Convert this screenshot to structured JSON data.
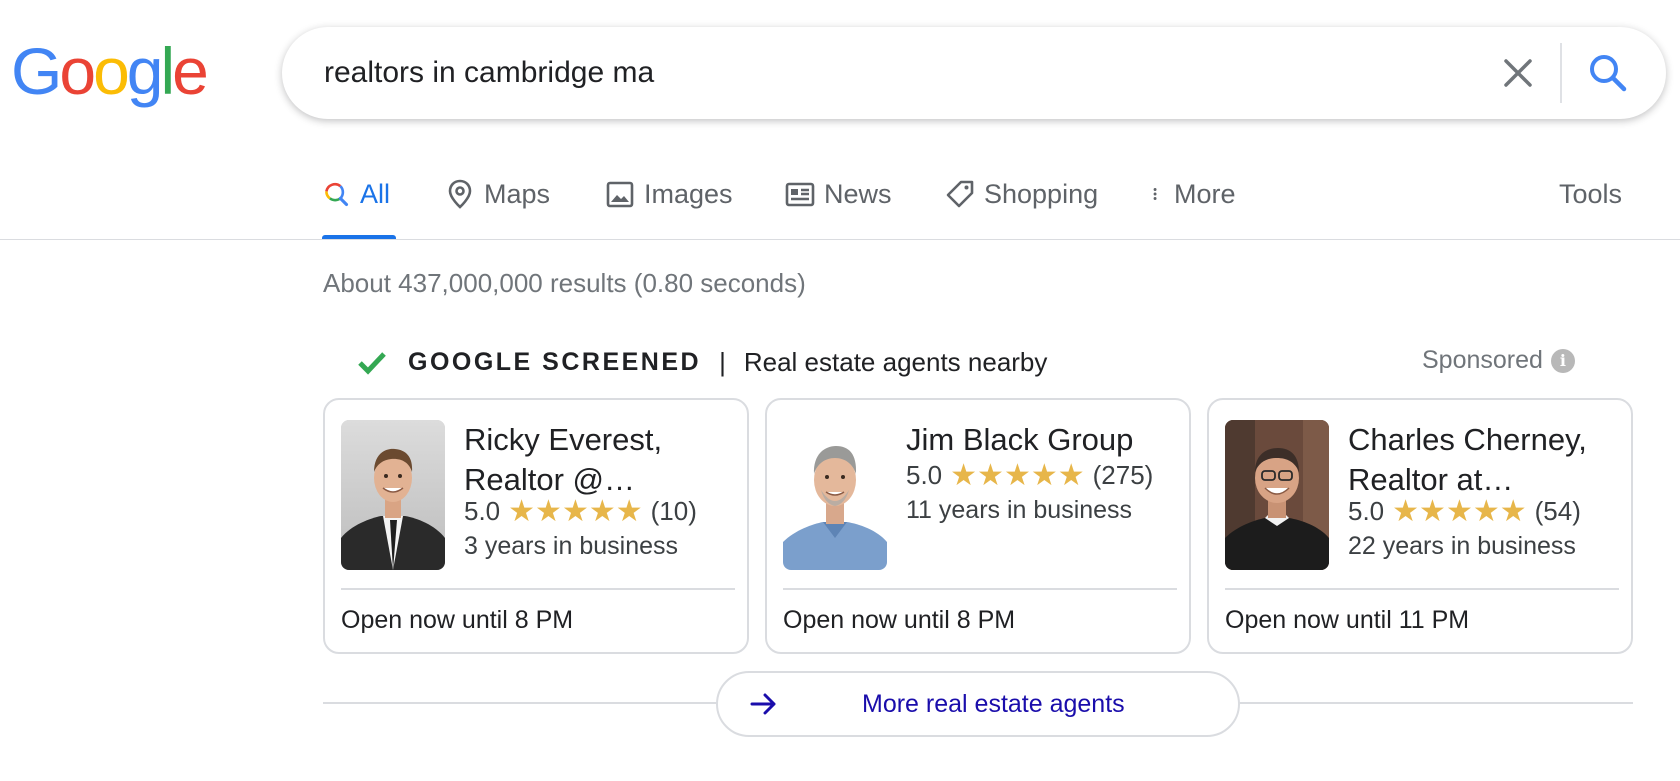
{
  "logo": {
    "letters": [
      "G",
      "o",
      "o",
      "g",
      "l",
      "e"
    ],
    "colors": [
      "#4285F4",
      "#EA4335",
      "#FBBC05",
      "#4285F4",
      "#34A853",
      "#EA4335"
    ]
  },
  "search": {
    "query": "realtors in cambridge ma",
    "clear_icon": "close-icon",
    "search_icon": "search-icon"
  },
  "tabs": [
    {
      "label": "All",
      "icon": "search-icon",
      "active": true
    },
    {
      "label": "Maps",
      "icon": "map-pin-icon"
    },
    {
      "label": "Images",
      "icon": "image-icon"
    },
    {
      "label": "News",
      "icon": "newspaper-icon"
    },
    {
      "label": "Shopping",
      "icon": "tag-icon"
    },
    {
      "label": "More",
      "icon": "more-vert-icon"
    }
  ],
  "tools_label": "Tools",
  "result_stats": "About 437,000,000 results (0.80 seconds)",
  "screened": {
    "title": "GOOGLE SCREENED",
    "separator": "|",
    "subtitle": "Real estate agents nearby",
    "sponsored": "Sponsored",
    "info_glyph": "i"
  },
  "agents": [
    {
      "name": "Ricky Everest, Realtor @…",
      "rating": "5.0",
      "stars": "★★★★★",
      "stars_count": 5,
      "reviews": "(10)",
      "years": "3 years in business",
      "hours": "Open now until 8 PM"
    },
    {
      "name": "Jim Black Group",
      "rating": "5.0",
      "stars": "★★★★★",
      "stars_count": 5,
      "reviews": "(275)",
      "years": "11 years in business",
      "hours": "Open now until 8 PM"
    },
    {
      "name": "Charles Cherney, Realtor at…",
      "rating": "5.0",
      "stars": "★★★★★",
      "stars_count": 5,
      "reviews": "(54)",
      "years": "22 years in business",
      "hours": "Open now until 11 PM"
    }
  ],
  "more_button": {
    "label": "More real estate agents",
    "icon": "arrow-right-icon"
  },
  "colors": {
    "accent": "#1a73e8",
    "link": "#1a0dab",
    "star": "#e7b64a",
    "check": "#34A853"
  }
}
